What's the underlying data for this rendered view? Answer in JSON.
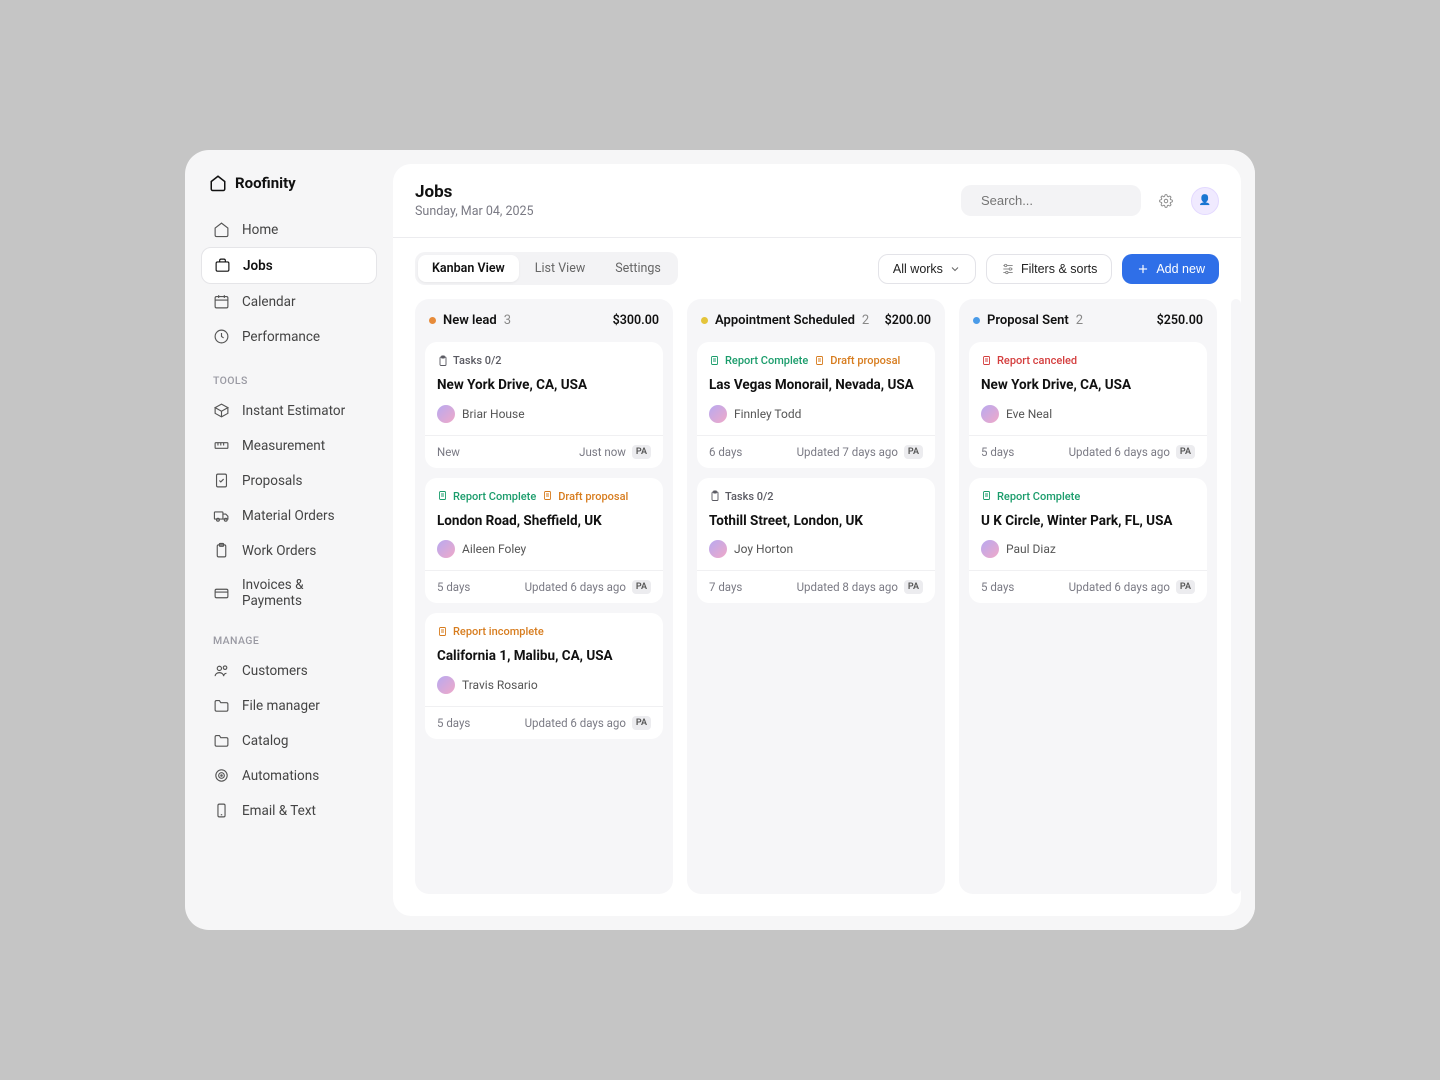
{
  "brand": "Roofinity",
  "nav_primary": [
    {
      "label": "Home",
      "icon": "home"
    },
    {
      "label": "Jobs",
      "icon": "briefcase",
      "active": true
    },
    {
      "label": "Calendar",
      "icon": "calendar"
    },
    {
      "label": "Performance",
      "icon": "clock"
    }
  ],
  "nav_sections": [
    {
      "label": "TOOLS",
      "items": [
        {
          "label": "Instant Estimator",
          "icon": "box"
        },
        {
          "label": "Measurement",
          "icon": "ruler"
        },
        {
          "label": "Proposals",
          "icon": "file-check"
        },
        {
          "label": "Material Orders",
          "icon": "truck"
        },
        {
          "label": "Work Orders",
          "icon": "clipboard"
        },
        {
          "label": "Invoices & Payments",
          "icon": "card"
        }
      ]
    },
    {
      "label": "MANAGE",
      "items": [
        {
          "label": "Customers",
          "icon": "users"
        },
        {
          "label": "File manager",
          "icon": "folder"
        },
        {
          "label": "Catalog",
          "icon": "folder"
        },
        {
          "label": "Automations",
          "icon": "target"
        },
        {
          "label": "Email & Text",
          "icon": "phone"
        }
      ]
    }
  ],
  "header": {
    "title": "Jobs",
    "subtitle": "Sunday, Mar 04, 2025",
    "search_placeholder": "Search..."
  },
  "tabs": [
    "Kanban View",
    "List View",
    "Settings"
  ],
  "active_tab": 0,
  "toolbar": {
    "works_filter": "All works",
    "filters_label": "Filters & sorts",
    "add_label": "Add new"
  },
  "columns": [
    {
      "name": "New lead",
      "color": "#e78b3a",
      "count": 3,
      "amount": "$300.00",
      "cards": [
        {
          "badges": [
            {
              "type": "gray",
              "icon": "clipboard",
              "text": "Tasks 0/2"
            }
          ],
          "title": "New York Drive, CA, USA",
          "assignee": "Briar House",
          "age": "New",
          "updated": "Just now",
          "pa": true
        },
        {
          "badges": [
            {
              "type": "green",
              "icon": "doc",
              "text": "Report Complete"
            },
            {
              "type": "orange",
              "icon": "doc",
              "text": "Draft proposal"
            }
          ],
          "title": "London Road, Sheffield, UK",
          "assignee": "Aileen Foley",
          "age": "5 days",
          "updated": "Updated 6 days ago",
          "pa": true
        },
        {
          "badges": [
            {
              "type": "orange",
              "icon": "doc",
              "text": "Report incomplete"
            }
          ],
          "title": "California 1, Malibu, CA, USA",
          "assignee": "Travis Rosario",
          "age": "5 days",
          "updated": "Updated 6 days ago",
          "pa": true
        }
      ]
    },
    {
      "name": "Appointment Scheduled",
      "color": "#e4c43a",
      "count": 2,
      "amount": "$200.00",
      "cards": [
        {
          "badges": [
            {
              "type": "green",
              "icon": "doc",
              "text": "Report Complete"
            },
            {
              "type": "orange",
              "icon": "doc",
              "text": "Draft proposal"
            }
          ],
          "title": "Las Vegas Monorail, Nevada, USA",
          "assignee": "Finnley Todd",
          "age": "6 days",
          "updated": "Updated 7 days ago",
          "pa": true
        },
        {
          "badges": [
            {
              "type": "gray",
              "icon": "clipboard",
              "text": "Tasks 0/2"
            }
          ],
          "title": "Tothill Street, London, UK",
          "assignee": "Joy Horton",
          "age": "7 days",
          "updated": "Updated 8 days ago",
          "pa": true
        }
      ]
    },
    {
      "name": "Proposal Sent",
      "color": "#4a9be8",
      "count": 2,
      "amount": "$250.00",
      "cards": [
        {
          "badges": [
            {
              "type": "red",
              "icon": "doc",
              "text": "Report canceled"
            }
          ],
          "title": "New York Drive, CA, USA",
          "assignee": "Eve Neal",
          "age": "5 days",
          "updated": "Updated 6 days ago",
          "pa": true
        },
        {
          "badges": [
            {
              "type": "green",
              "icon": "doc",
              "text": "Report Complete"
            }
          ],
          "title": "U K Circle, Winter Park, FL, USA",
          "assignee": "Paul Diaz",
          "age": "5 days",
          "updated": "Updated 6 days ago",
          "pa": true
        }
      ]
    }
  ]
}
